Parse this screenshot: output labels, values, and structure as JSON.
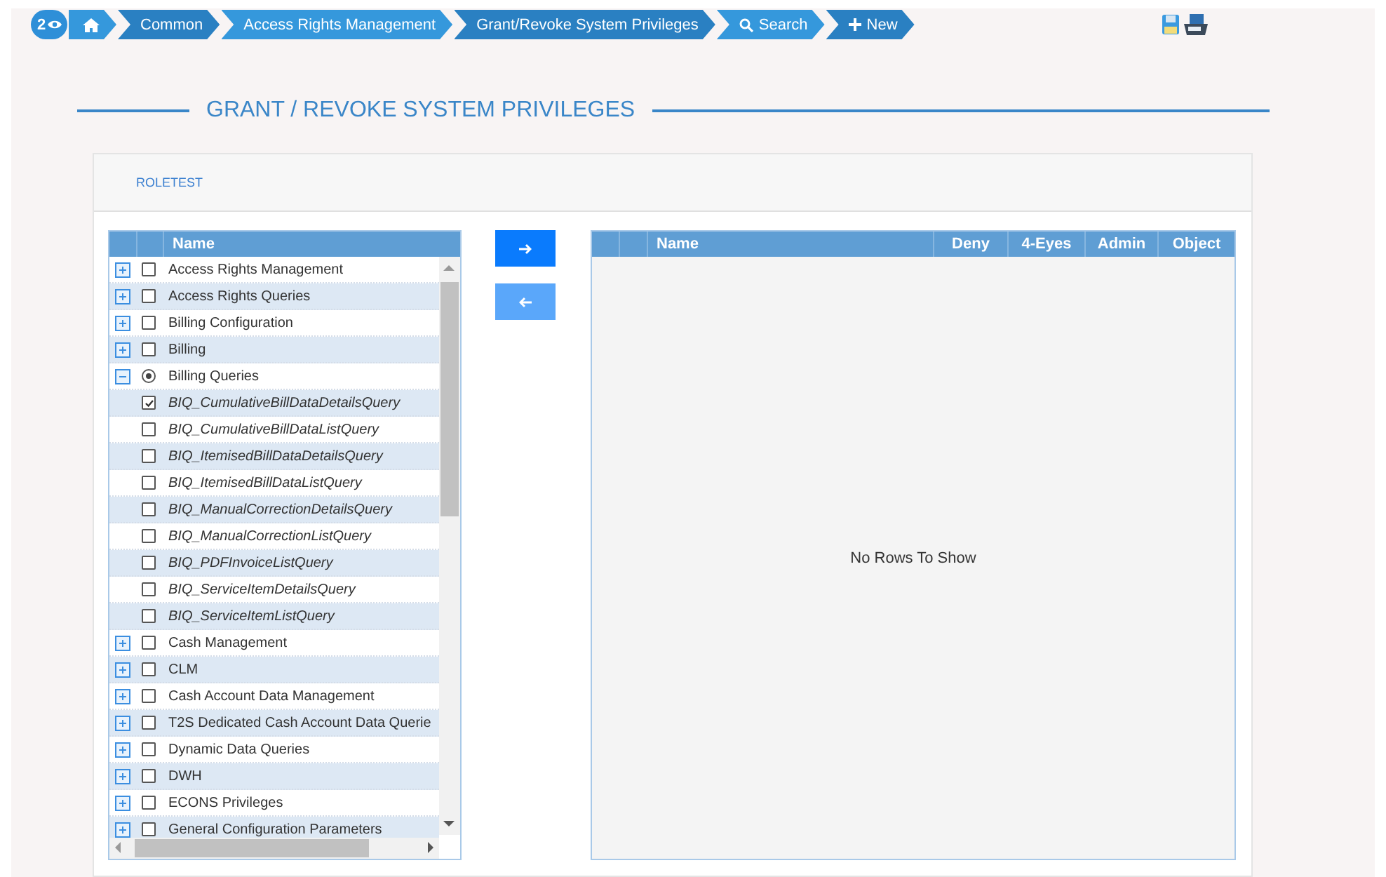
{
  "breadcrumb": {
    "count": "2",
    "items": [
      {
        "kind": "home"
      },
      {
        "kind": "text",
        "label": "Common"
      },
      {
        "kind": "text",
        "label": "Access Rights Management"
      },
      {
        "kind": "text",
        "label": "Grant/Revoke System Privileges"
      },
      {
        "kind": "search",
        "label": "Search"
      },
      {
        "kind": "new",
        "label": "New"
      }
    ]
  },
  "heading": "GRANT / REVOKE SYSTEM PRIVILEGES",
  "role": "ROLETEST",
  "tree": {
    "column": "Name",
    "items": [
      {
        "label": "Access Rights Management",
        "checked": false,
        "partial": false,
        "expanded": false
      },
      {
        "label": "Access Rights Queries",
        "checked": false,
        "partial": false,
        "expanded": false
      },
      {
        "label": "Billing Configuration",
        "checked": false,
        "partial": false,
        "expanded": false
      },
      {
        "label": "Billing",
        "checked": false,
        "partial": false,
        "expanded": false
      },
      {
        "label": "Billing Queries",
        "checked": false,
        "partial": true,
        "expanded": true,
        "children": [
          {
            "label": "BIQ_CumulativeBillDataDetailsQuery",
            "checked": true,
            "partial": false
          },
          {
            "label": "BIQ_CumulativeBillDataListQuery",
            "checked": false,
            "partial": false
          },
          {
            "label": "BIQ_ItemisedBillDataDetailsQuery",
            "checked": false,
            "partial": false
          },
          {
            "label": "BIQ_ItemisedBillDataListQuery",
            "checked": false,
            "partial": false
          },
          {
            "label": "BIQ_ManualCorrectionDetailsQuery",
            "checked": false,
            "partial": false
          },
          {
            "label": "BIQ_ManualCorrectionListQuery",
            "checked": false,
            "partial": false
          },
          {
            "label": "BIQ_PDFInvoiceListQuery",
            "checked": false,
            "partial": false
          },
          {
            "label": "BIQ_ServiceItemDetailsQuery",
            "checked": false,
            "partial": false
          },
          {
            "label": "BIQ_ServiceItemListQuery",
            "checked": false,
            "partial": false
          }
        ]
      },
      {
        "label": "Cash Management",
        "checked": false,
        "partial": false,
        "expanded": false
      },
      {
        "label": "CLM",
        "checked": false,
        "partial": false,
        "expanded": false
      },
      {
        "label": "Cash Account Data Management",
        "checked": false,
        "partial": false,
        "expanded": false
      },
      {
        "label": "T2S Dedicated Cash Account Data Querie",
        "checked": false,
        "partial": false,
        "expanded": false
      },
      {
        "label": "Dynamic Data Queries",
        "checked": false,
        "partial": false,
        "expanded": false
      },
      {
        "label": "DWH",
        "checked": false,
        "partial": false,
        "expanded": false
      },
      {
        "label": "ECONS Privileges",
        "checked": false,
        "partial": false,
        "expanded": false
      },
      {
        "label": "General Configuration Parameters",
        "checked": false,
        "partial": false,
        "expanded": false
      }
    ]
  },
  "move_buttons": [
    {
      "kind": "add",
      "disabled": false
    },
    {
      "kind": "remove",
      "disabled": true
    }
  ],
  "granted": {
    "columns": [
      "Name",
      "Deny",
      "4-Eyes",
      "Admin",
      "Object"
    ],
    "empty_text": "No Rows To Show"
  }
}
